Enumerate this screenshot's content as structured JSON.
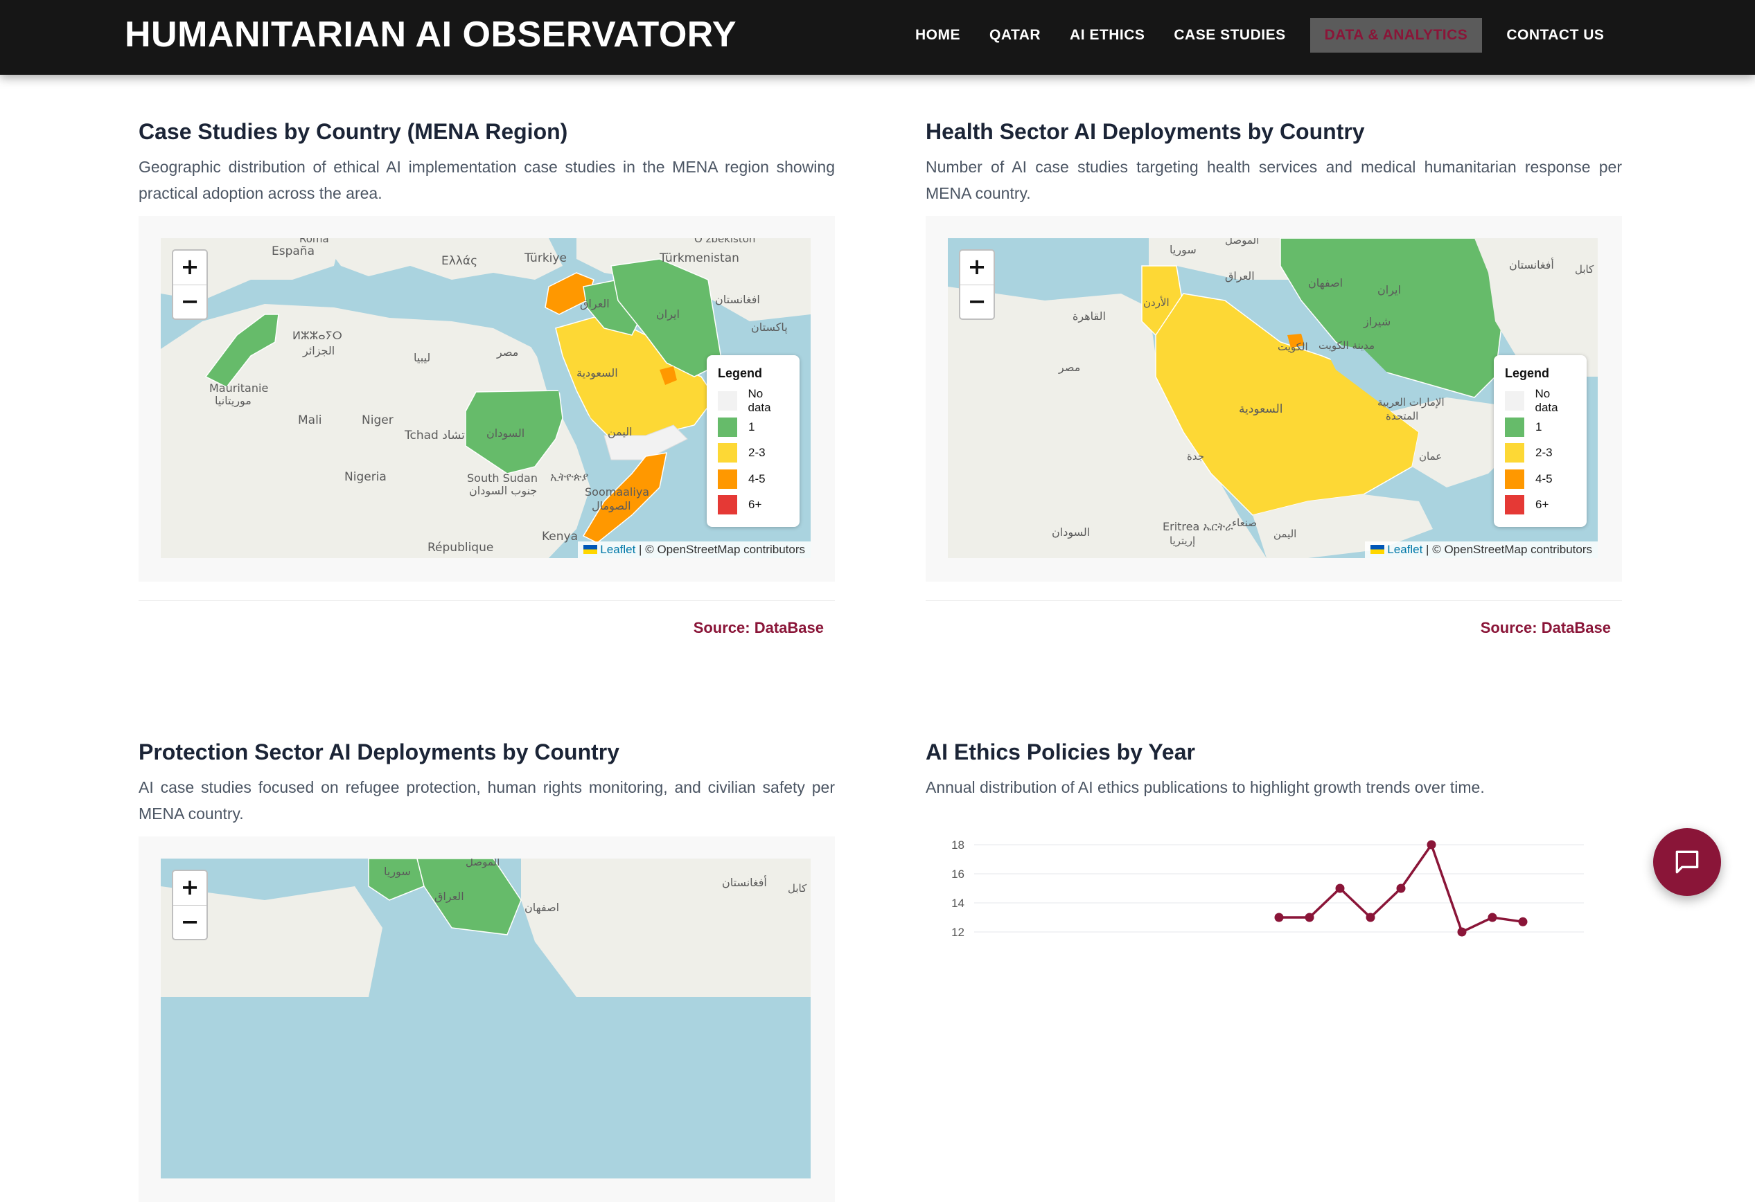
{
  "header": {
    "brand": "HUMANITARIAN AI OBSERVATORY",
    "nav": [
      {
        "label": "HOME"
      },
      {
        "label": "QATAR"
      },
      {
        "label": "AI ETHICS"
      },
      {
        "label": "CASE STUDIES"
      },
      {
        "label": "DATA & ANALYTICS",
        "active": true
      },
      {
        "label": "CONTACT US"
      }
    ]
  },
  "legend": {
    "title": "Legend",
    "items": [
      {
        "label": "No data",
        "color": "#f2f2f2"
      },
      {
        "label": "1",
        "color": "#66bb6a"
      },
      {
        "label": "2-3",
        "color": "#fdd835"
      },
      {
        "label": "4-5",
        "color": "#ff9800"
      },
      {
        "label": "6+",
        "color": "#e53935"
      }
    ]
  },
  "map_controls": {
    "zoom_in": "+",
    "zoom_out": "−"
  },
  "attribution": {
    "leaflet": "Leaflet",
    "rest": " | © OpenStreetMap contributors"
  },
  "cards": {
    "mena": {
      "title": "Case Studies by Country (MENA Region)",
      "description": "Geographic distribution of ethical AI implementation case studies in the MENA region showing practical adoption across the area.",
      "source": "Source: DataBase",
      "map_labels": [
        "España",
        "Ελλάς",
        "Türkiye",
        "Türkmenistan",
        "Oʻzbekiston",
        "ⵍⵣⵣⴰⵢⵔ",
        "الجزائر",
        "ليبيا",
        "مصر",
        "العراق",
        "ایران",
        "افغانستان",
        "پاکستان",
        "السعودية",
        "اليمن",
        "Mauritanie",
        "موريتانيا",
        "Mali",
        "Niger",
        "Tchad تشاد",
        "السودان",
        "Nigeria",
        "South Sudan",
        "جنوب السودان",
        "ኢትዮጵያ",
        "Soomaaliya",
        "الصومال",
        "Kenya",
        "République",
        "Roma"
      ]
    },
    "health": {
      "title": "Health Sector AI Deployments by Country",
      "description": "Number of AI case studies targeting health services and medical humanitarian response per MENA country.",
      "source": "Source: DataBase",
      "map_labels": [
        "الموصل",
        "سوريا",
        "العراق",
        "أفغانستان",
        "كابل",
        "القاهرة",
        "مصر",
        "الأردن",
        "اصفهان",
        "ایران",
        "شیراز",
        "الكويت",
        "مدينة الكويت",
        "الإمارات العربية المتحدة",
        "السعودية",
        "جدة",
        "عمان",
        "السودان",
        "صنعاء",
        "اليمن",
        "Eritrea ኤርትራ",
        "إريتريا"
      ]
    },
    "protection": {
      "title": "Protection Sector AI Deployments by Country",
      "description": "AI case studies focused on refugee protection, human rights monitoring, and civilian safety per MENA country.",
      "map_labels": [
        "الموصل",
        "سوريا",
        "العراق",
        "أفغانستان",
        "كابل",
        "اصفهان"
      ]
    },
    "policies": {
      "title": "AI Ethics Policies by Year",
      "description": "Annual distribution of AI ethics publications to highlight growth trends over time."
    }
  },
  "chart_data": {
    "type": "line",
    "title": "",
    "y_ticks": [
      "18",
      "16",
      "14",
      "12"
    ],
    "ylim": [
      12,
      18
    ],
    "series": [
      {
        "values": [
          13,
          13,
          15,
          13,
          15,
          18,
          12,
          13,
          12.7
        ]
      }
    ],
    "color": "#8a1538",
    "grid": true
  },
  "fab": {
    "icon": "chat-bubble-icon"
  }
}
